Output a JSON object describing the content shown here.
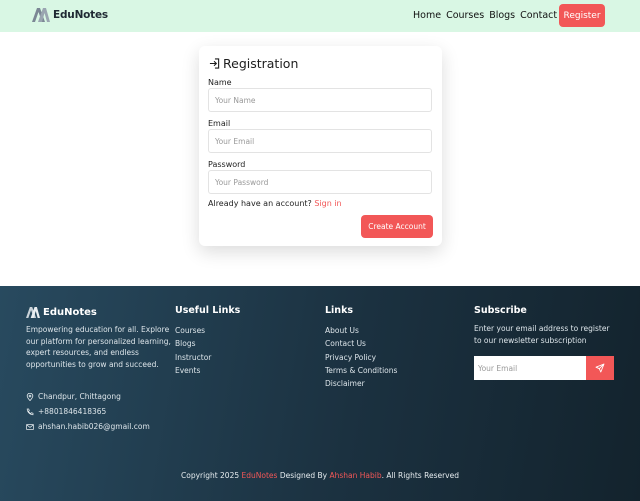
{
  "nav": {
    "brand": "EduNotes",
    "links": [
      "Home",
      "Courses",
      "Blogs",
      "Contact Us"
    ],
    "register": "Register"
  },
  "form": {
    "title": "Registration",
    "fields": [
      {
        "label": "Name",
        "placeholder": "Your Name"
      },
      {
        "label": "Email",
        "placeholder": "Your Email"
      },
      {
        "label": "Password",
        "placeholder": "Your Password"
      }
    ],
    "already_text": "Already have an account?",
    "signin_link": "Sign in",
    "submit": "Create Account"
  },
  "footer": {
    "brand": "EduNotes",
    "description": "Empowering education for all. Explore our platform for personalized learning, expert resources, and endless opportunities to grow and succeed.",
    "address": "Chandpur, Chittagong",
    "phone": "+8801846418365",
    "email": "ahshan.habib026@gmail.com",
    "useful_links": {
      "title": "Useful Links",
      "items": [
        "Courses",
        "Blogs",
        "Instructor",
        "Events"
      ]
    },
    "links": {
      "title": "Links",
      "items": [
        "About Us",
        "Contact Us",
        "Privacy Policy",
        "Terms & Conditions",
        "Disclaimer"
      ]
    },
    "subscribe": {
      "title": "Subscribe",
      "text": "Enter your email address to register to our newsletter subscription",
      "placeholder": "Your Email"
    },
    "copyright": {
      "prefix": "Copyright 2025",
      "brand": "EduNotes",
      "designed_by": "Designed By",
      "author": "Ahshan Habib",
      "suffix": ". All Rights Reserved"
    }
  },
  "colors": {
    "accent": "#f25757",
    "nav_bg": "#d9f7e4",
    "footer_bg": "#1b3140"
  }
}
